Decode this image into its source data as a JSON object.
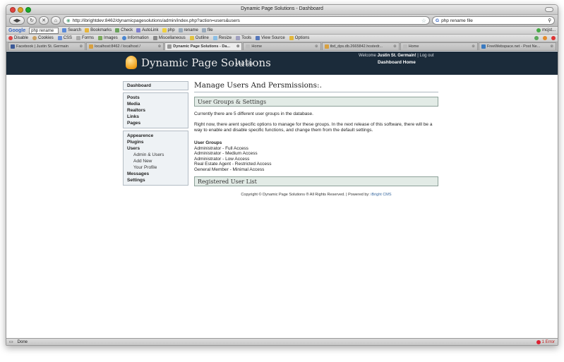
{
  "window": {
    "title": "Dynamic Page Solutions - Dashboard"
  },
  "nav": {
    "url": "http://ibrightdev:8462/dynamicpagesolutions/admin/index.php?action=users&users",
    "search_value": "php rename file"
  },
  "google_toolbar": {
    "logo": "Google",
    "query": "php rename",
    "items": [
      "Search",
      "Bookmarks",
      "Check",
      "AutoLink",
      "php",
      "rename",
      "file"
    ],
    "right_item": "mcjst..."
  },
  "webdev_toolbar": {
    "items": [
      "Disable",
      "Cookies",
      "CSS",
      "Forms",
      "Images",
      "Information",
      "Miscellaneous",
      "Outline",
      "Resize",
      "Tools",
      "View Source",
      "Options"
    ]
  },
  "tabs": [
    {
      "label": "Facebook | Justin St. Germain",
      "active": false
    },
    {
      "label": "localhost:8462 / localhost /",
      "active": false
    },
    {
      "label": "Dynamic Page Solutions - Da...",
      "active": true
    },
    {
      "label": "Home",
      "active": false
    },
    {
      "label": "tbd_dps.db.2665842.hostedr...",
      "active": false
    },
    {
      "label": "Home",
      "active": false
    },
    {
      "label": "FreeWebspace.net - Post Ne...",
      "active": false
    }
  ],
  "site": {
    "title": "Dynamic Page Solutions",
    "visit_site": "← Visit site",
    "welcome_prefix": "Welcome",
    "welcome_user": "Justin St. Germain!",
    "logout": "Log out",
    "dashboard_home": "Dashboard Home"
  },
  "sidebar": {
    "dashboard": "Dashboard",
    "content": [
      "Posts",
      "Media",
      "Realtors",
      "Links",
      "Pages"
    ],
    "admin": {
      "appearance": "Appearence",
      "plugins": "Plugins",
      "users": "Users",
      "users_sub": [
        "Admin & Users",
        "Add New",
        "Your Profile"
      ],
      "messages": "Messages",
      "settings": "Settings"
    }
  },
  "main": {
    "heading": "Manage Users And Persmissions:.",
    "panel1_title": "User Groups & Settings",
    "para1": "Currently there are 5 different user groups in the database.",
    "para2": "Right now, there arent specific options to manage for these groups. In the next release of this software, there will be a way to enable and disable specific functions, and change them from the default settings.",
    "groups_heading": "User Groups",
    "groups": [
      "Administrator - Full Access",
      "Administrator - Medium Access",
      "Administrator - Low Access",
      "Real Estate Agent - Restricted Access",
      "General Member - Minimal Access"
    ],
    "panel2_title": "Registered User List",
    "copyright": "Copyright © Dynamic Page Solutions ® All Rights Reserved. | Powered by:",
    "powered_link": "iBright CMS"
  },
  "status": {
    "text": "Done",
    "errors": "1 Error"
  }
}
